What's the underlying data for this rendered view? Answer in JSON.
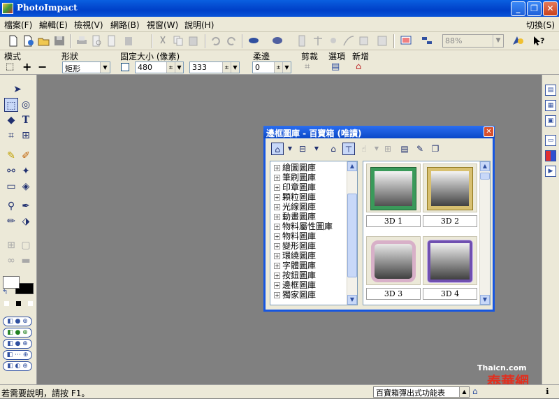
{
  "window": {
    "title": "PhotoImpact",
    "minimize": "_",
    "restore": "❐",
    "close": "✕"
  },
  "menubar": {
    "items": [
      "檔案(F)",
      "編輯(E)",
      "檢視(V)",
      "網路(B)",
      "視窗(W)",
      "說明(H)"
    ],
    "switch": "切換(S)"
  },
  "toolbar": {
    "zoom": "88%"
  },
  "attributes": {
    "mode_label": "模式",
    "shape_label": "形狀",
    "shape_value": "矩形",
    "fixed_label": "固定大小 (像素)",
    "width_value": "480",
    "height_value": "333",
    "soft_label": "柔邊",
    "soft_value": "0",
    "crop_label": "剪裁",
    "options_label": "選項",
    "add_label": "新增"
  },
  "dialog": {
    "title": "邊框圖庫 - 百寶箱 (唯讀)",
    "tree": [
      "繪圖圖庫",
      "筆刷圖庫",
      "印章圖庫",
      "顆粒圖庫",
      "光線圖庫",
      "動畫圖庫",
      "物料屬性圖庫",
      "物料圖庫",
      "變形圖庫",
      "環繞圖庫",
      "字體圖庫",
      "按鈕圖庫",
      "邊框圖庫",
      "獨家圖庫"
    ],
    "gallery": [
      {
        "label": "3D 1",
        "color": "#3a9a5a"
      },
      {
        "label": "3D 2",
        "color": "#d8c070"
      },
      {
        "label": "3D 3",
        "color": "#d8b0c8"
      },
      {
        "label": "3D 4",
        "color": "#7050b0"
      }
    ]
  },
  "status": {
    "text": "若需要說明，請按 F1。",
    "combo": "百寶箱彈出式功能表"
  },
  "watermark": {
    "line1": "Thaicn.com",
    "line2": "泰華網"
  }
}
